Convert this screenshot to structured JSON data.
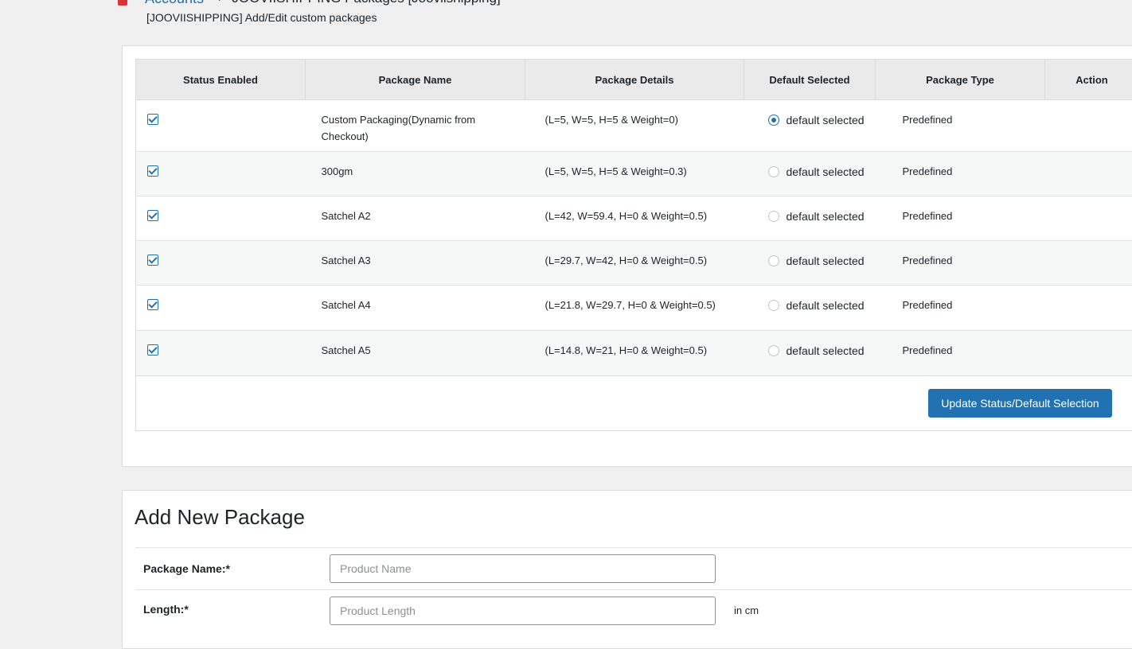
{
  "breadcrumb": {
    "root": "Accounts",
    "separator": "›",
    "current": "JOOVIISHIPPING Packages [Jooviishipping]"
  },
  "subtitle": "[JOOVIISHIPPING] Add/Edit custom packages",
  "table": {
    "headers": [
      "Status Enabled",
      "Package Name",
      "Package Details",
      "Default Selected",
      "Package Type",
      "Action"
    ],
    "rows": [
      {
        "enabled": true,
        "name": "Custom Packaging(Dynamic from Checkout)",
        "details": "(L=5, W=5, H=5 & Weight=0)",
        "default": true,
        "default_label": "default selected",
        "type": "Predefined",
        "action": ""
      },
      {
        "enabled": true,
        "name": "300gm",
        "details": "(L=5, W=5, H=5 & Weight=0.3)",
        "default": false,
        "default_label": "default selected",
        "type": "Predefined",
        "action": ""
      },
      {
        "enabled": true,
        "name": "Satchel A2",
        "details": "(L=42, W=59.4, H=0 & Weight=0.5)",
        "default": false,
        "default_label": "default selected",
        "type": "Predefined",
        "action": ""
      },
      {
        "enabled": true,
        "name": "Satchel A3",
        "details": "(L=29.7, W=42, H=0 & Weight=0.5)",
        "default": false,
        "default_label": "default selected",
        "type": "Predefined",
        "action": ""
      },
      {
        "enabled": true,
        "name": "Satchel A4",
        "details": "(L=21.8, W=29.7, H=0 & Weight=0.5)",
        "default": false,
        "default_label": "default selected",
        "type": "Predefined",
        "action": ""
      },
      {
        "enabled": true,
        "name": "Satchel A5",
        "details": "(L=14.8, W=21, H=0 & Weight=0.5)",
        "default": false,
        "default_label": "default selected",
        "type": "Predefined",
        "action": ""
      }
    ]
  },
  "update_button": "Update Status/Default Selection",
  "add_package": {
    "title": "Add New Package",
    "fields": [
      {
        "label": "Package Name:*",
        "placeholder": "Product Name",
        "value": "",
        "unit": ""
      },
      {
        "label": "Length:*",
        "placeholder": "Product Length",
        "value": "",
        "unit": "in cm"
      }
    ]
  },
  "colors": {
    "accent": "#2271b1",
    "background": "#f0f0f1",
    "logo": "#d63638"
  }
}
